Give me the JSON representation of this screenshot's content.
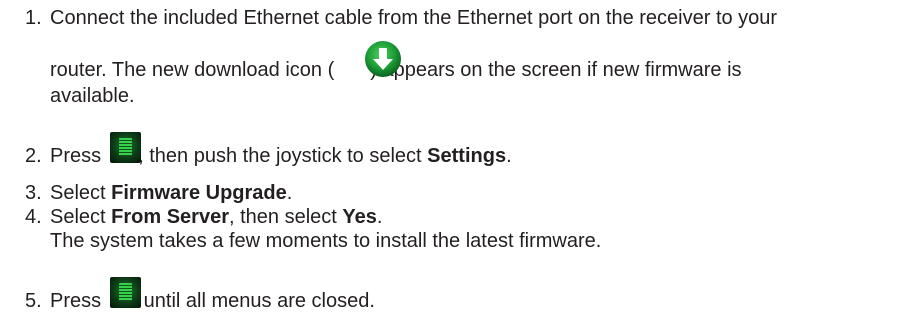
{
  "steps": [
    {
      "number": "1.",
      "line1": "Connect the included Ethernet cable from the Ethernet port on the receiver to your",
      "line2_before": "router. The new download icon (",
      "line2_after": ") appears on the screen if new firmware is",
      "line3": "available.",
      "icon": "download-icon"
    },
    {
      "number": "2.",
      "before": "Press",
      "after_icon": ", then push the joystick to select ",
      "bold": "Settings",
      "after_bold": ".",
      "icon": "menu-button-icon"
    },
    {
      "number": "3.",
      "before": "Select ",
      "bold": "Firmware Upgrade",
      "after_bold": "."
    },
    {
      "number": "4.",
      "before": "Select ",
      "bold": "From Server",
      "middle": ", then select ",
      "bold2": "Yes",
      "after_bold2": ".",
      "line2": "The system takes a few moments to install the latest firmware."
    },
    {
      "number": "5.",
      "before": "Press",
      "after_icon": " until all menus are closed.",
      "icon": "menu-button-icon"
    }
  ],
  "colors": {
    "text": "#231f20",
    "icon_green": "#1a9a35"
  }
}
